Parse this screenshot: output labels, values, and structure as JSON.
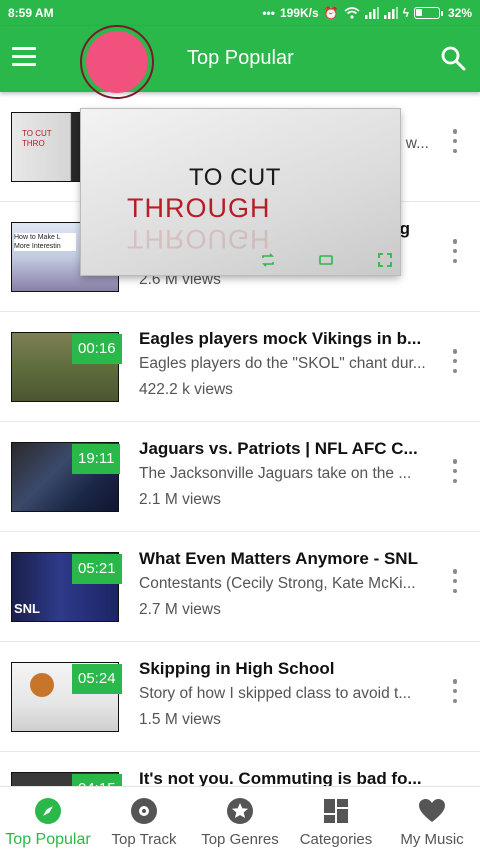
{
  "status": {
    "time": "8:59 AM",
    "speed": "199K/s",
    "battery": "32%",
    "battery_level": 0.32
  },
  "app": {
    "title": "Top Popular",
    "accent": "#2bb84a"
  },
  "mini_player": {
    "line1": "TO CUT",
    "line2": "THROUGH"
  },
  "videos": [
    {
      "duration": "",
      "title": "",
      "desc": "w...",
      "views": "",
      "thumb_text": "TO CUT THRO"
    },
    {
      "duration": "",
      "title": "g",
      "desc": "",
      "views": "2.6 M views",
      "thumb_text": "How to Make L More Interestin"
    },
    {
      "duration": "00:16",
      "title": "Eagles players mock Vikings in b...",
      "desc": "Eagles players do the \"SKOL\" chant dur...",
      "views": "422.2 k views"
    },
    {
      "duration": "19:11",
      "title": "Jaguars vs. Patriots | NFL AFC C...",
      "desc": "The Jacksonville Jaguars take on the ...",
      "views": "2.1 M views"
    },
    {
      "duration": "05:21",
      "title": "What Even Matters Anymore - SNL",
      "desc": "Contestants (Cecily Strong, Kate McKi...",
      "views": "2.7 M views",
      "thumb_text": "SNL"
    },
    {
      "duration": "05:24",
      "title": "Skipping in High School",
      "desc": "Story of how I skipped class to avoid t...",
      "views": "1.5 M views"
    },
    {
      "duration": "04:15",
      "title": "It's not you. Commuting is bad fo...",
      "desc": "",
      "views": ""
    }
  ],
  "nav": [
    {
      "label": "Top Popular",
      "icon": "compass-icon",
      "active": true
    },
    {
      "label": "Top Track",
      "icon": "disc-icon",
      "active": false
    },
    {
      "label": "Top Genres",
      "icon": "star-icon",
      "active": false
    },
    {
      "label": "Categories",
      "icon": "grid-icon",
      "active": false
    },
    {
      "label": "My Music",
      "icon": "heart-icon",
      "active": false
    }
  ]
}
